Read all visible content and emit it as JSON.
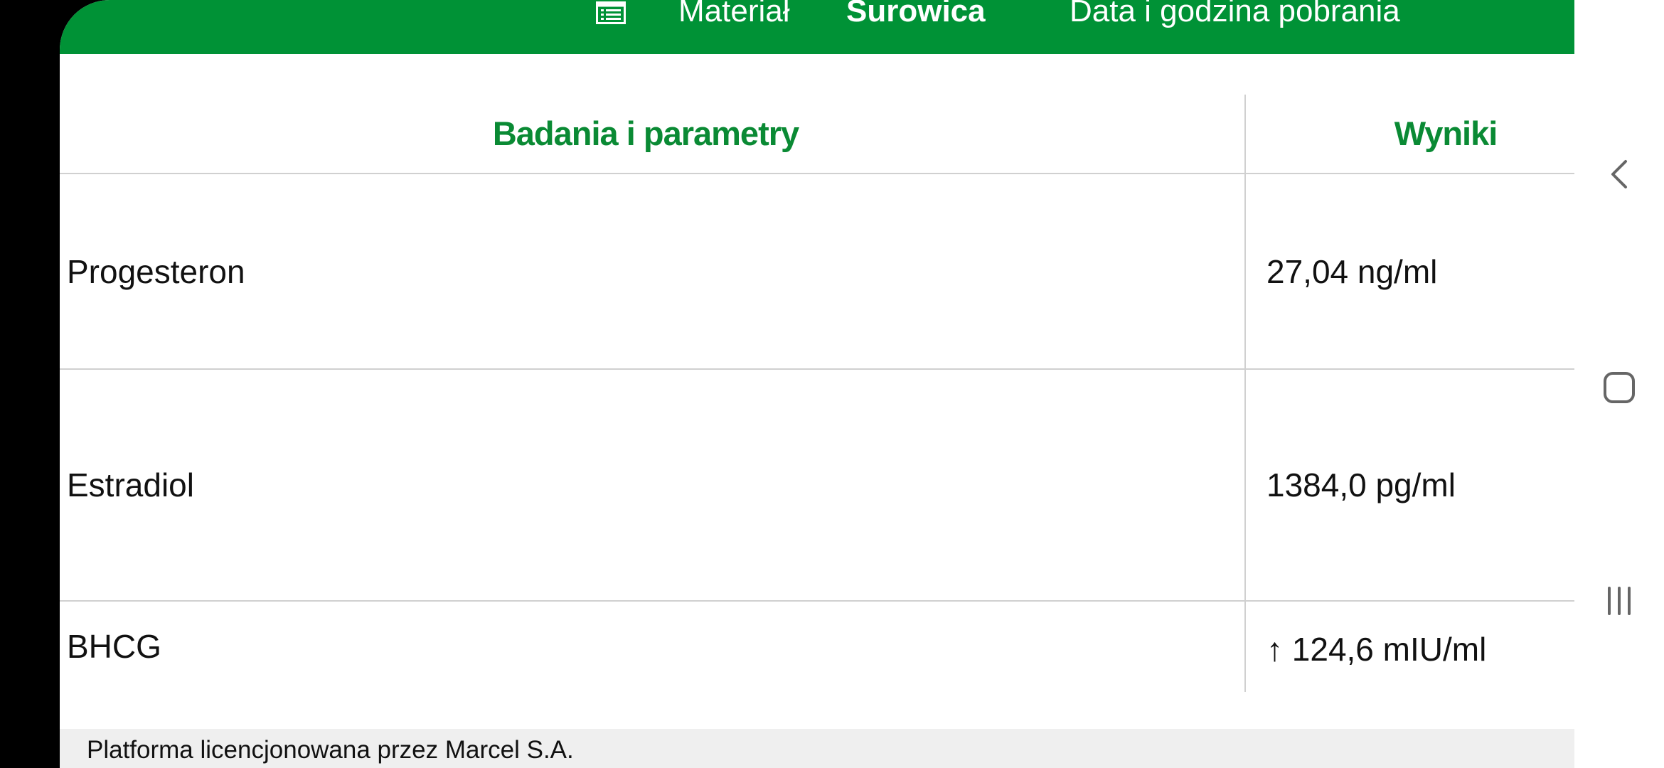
{
  "header": {
    "material_label": "Materiał",
    "material_value": "Surowica",
    "date_label": "Data i godzina pobrania",
    "icon": "document-list-icon"
  },
  "table": {
    "columns": [
      "Badania i parametry",
      "Wyniki"
    ],
    "rows": [
      {
        "parameter": "Progesteron",
        "result": "27,04 ng/ml"
      },
      {
        "parameter": "Estradiol",
        "result": "1384,0 pg/ml"
      },
      {
        "parameter": "BHCG",
        "result": "↑ 124,6 mIU/ml"
      }
    ]
  },
  "footer": {
    "text": "Platforma licencjonowana przez Marcel S.A."
  },
  "navbar": {
    "icons": [
      "back-icon",
      "home-icon",
      "recent-apps-icon"
    ]
  },
  "colors": {
    "accent": "#009236",
    "header_text": "#0a8a34"
  }
}
